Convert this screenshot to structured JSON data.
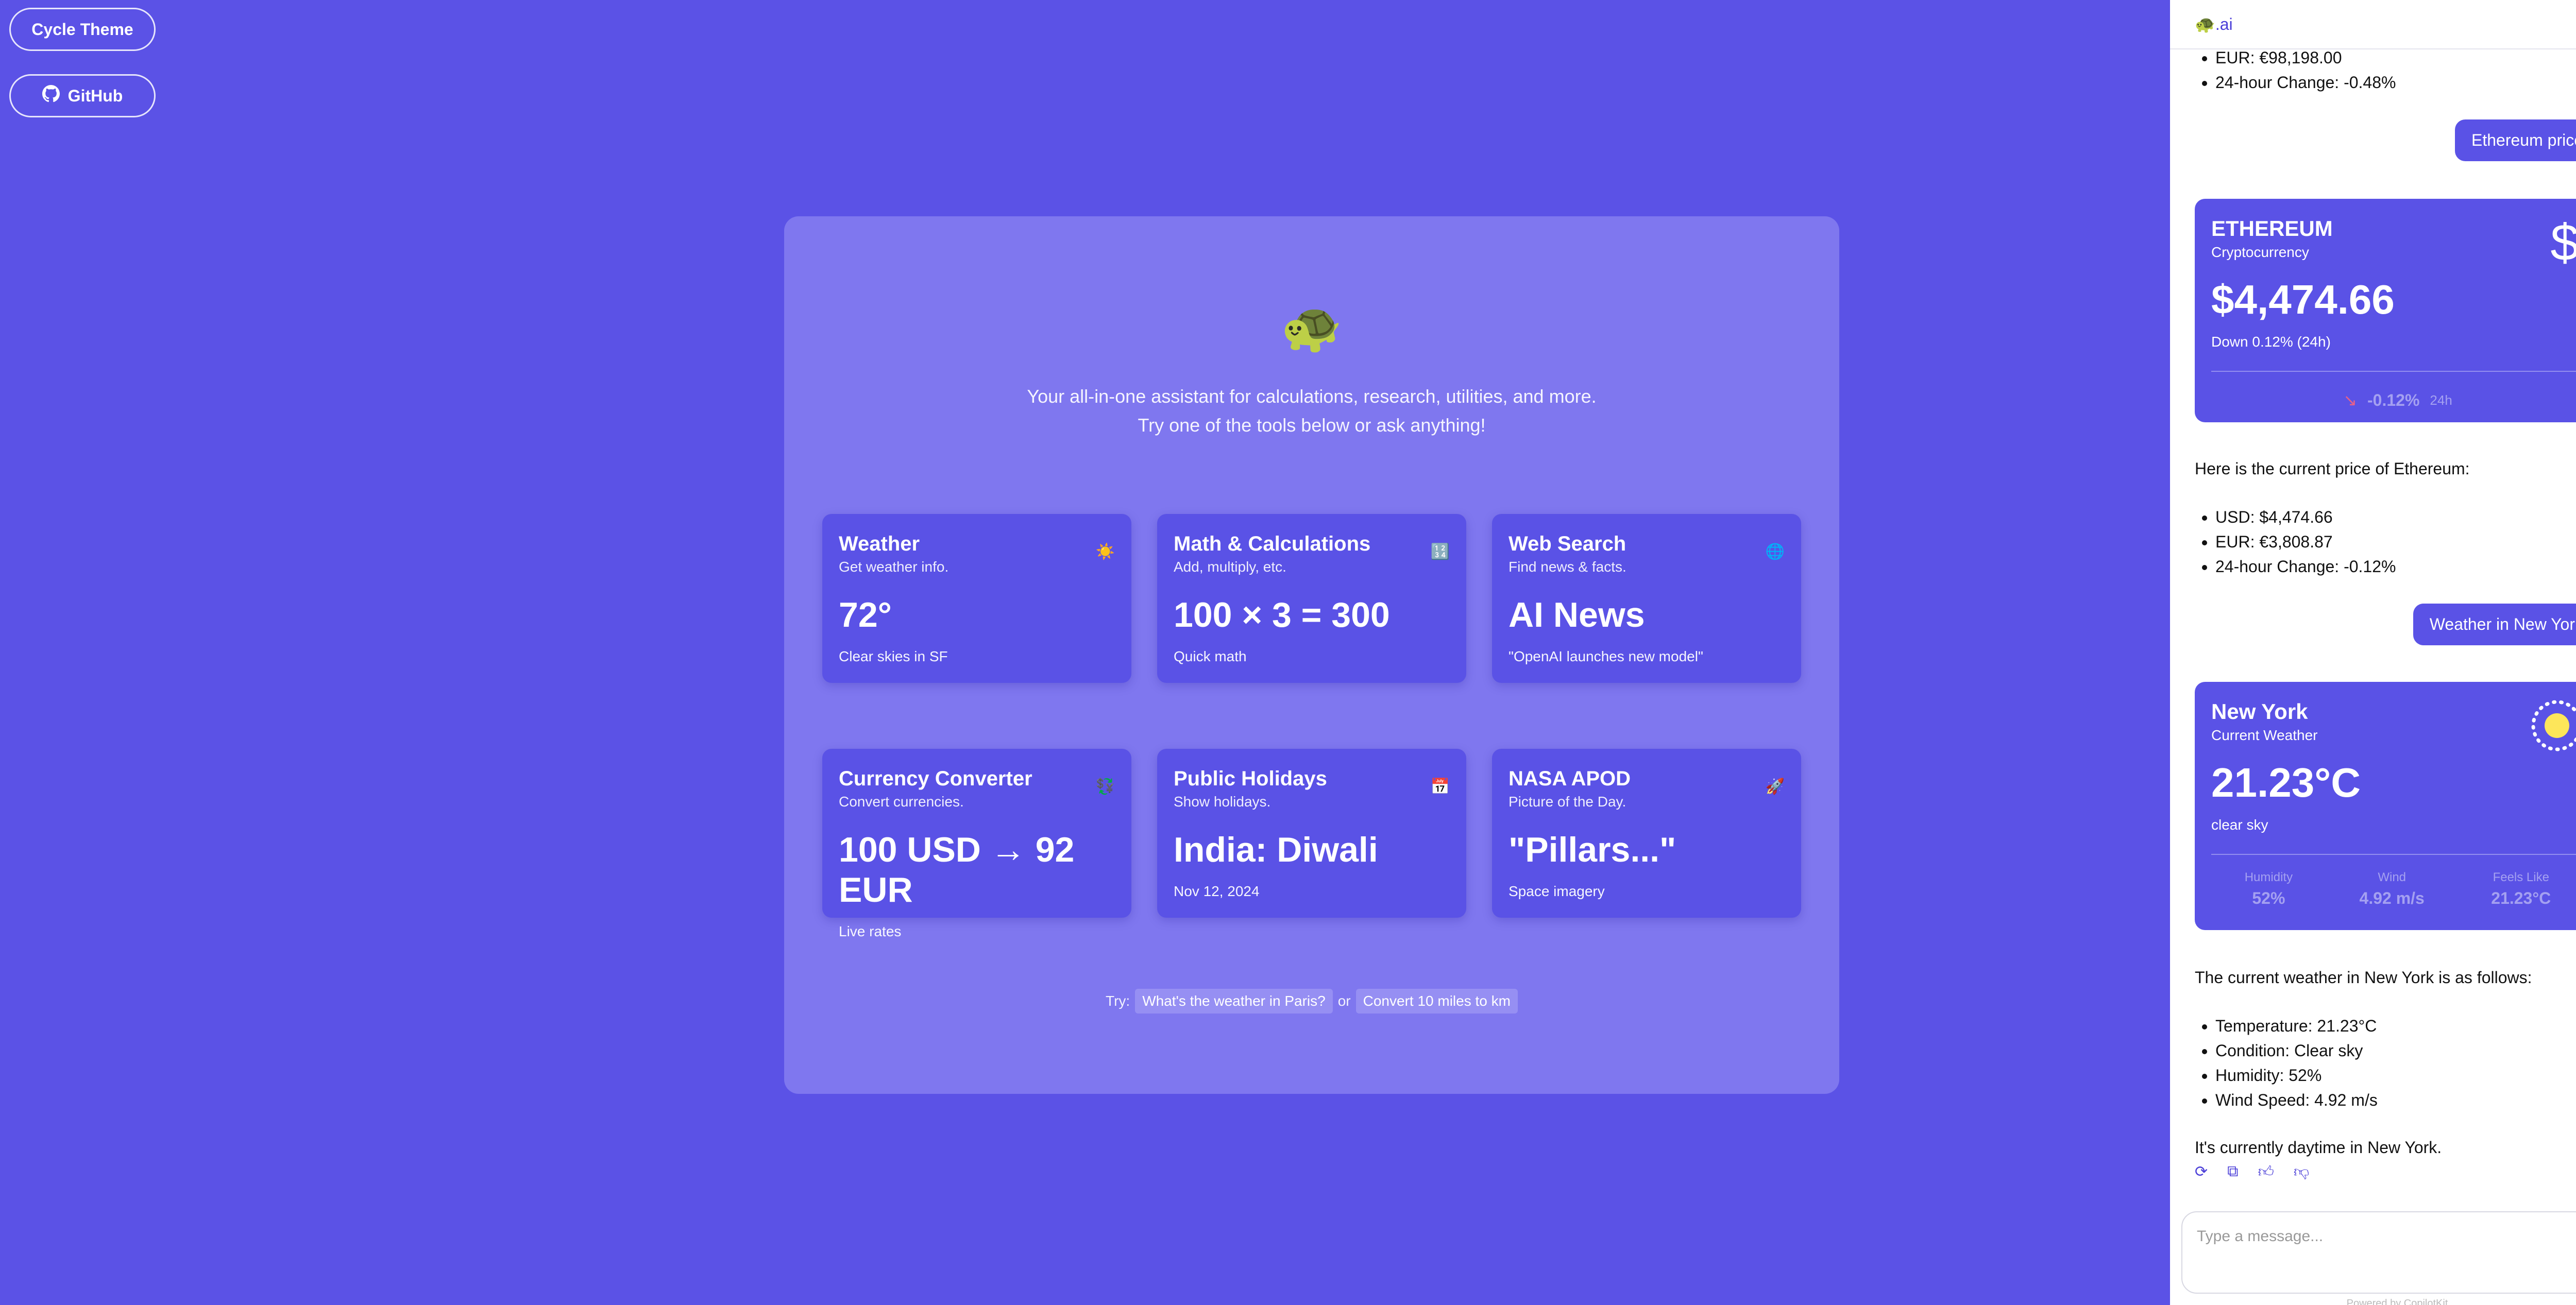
{
  "top_buttons": {
    "cycle_theme": "Cycle Theme",
    "github": "GitHub"
  },
  "hero": {
    "logo": "🐢",
    "line1": "Your all-in-one assistant for calculations, research, utilities, and more.",
    "line2": "Try one of the tools below or ask anything!"
  },
  "cards": [
    {
      "title": "Weather",
      "sub": "Get weather info.",
      "value": "72°",
      "note": "Clear skies in SF",
      "icon": "☀️"
    },
    {
      "title": "Math & Calculations",
      "sub": "Add, multiply, etc.",
      "value": "100 × 3 = 300",
      "note": "Quick math",
      "icon": "🔢"
    },
    {
      "title": "Web Search",
      "sub": "Find news & facts.",
      "value": "AI News",
      "note": "\"OpenAI launches new model\"",
      "icon": "🌐"
    },
    {
      "title": "Currency Converter",
      "sub": "Convert currencies.",
      "value": "100 USD → 92 EUR",
      "note": "Live rates",
      "icon": "💱"
    },
    {
      "title": "Public Holidays",
      "sub": "Show holidays.",
      "value": "India: Diwali",
      "note": "Nov 12, 2024",
      "icon": "📅"
    },
    {
      "title": "NASA APOD",
      "sub": "Picture of the Day.",
      "value": "\"Pillars...\"",
      "note": "Space imagery",
      "icon": "🚀"
    }
  ],
  "try": {
    "label": "Try:",
    "chip1": "What's the weather in Paris?",
    "or": "or",
    "chip2": "Convert 10 miles to km"
  },
  "chat": {
    "brand": "🐢.ai",
    "prev_items": [
      "EUR: €98,198.00",
      "24-hour Change: -0.48%"
    ],
    "user_msg1": "Ethereum price",
    "eth_card": {
      "title": "ETHEREUM",
      "sub": "Cryptocurrency",
      "value": "$4,474.66",
      "note": "Down 0.12% (24h)",
      "change": "-0.12%",
      "period": "24h",
      "icon": "dollar-icon"
    },
    "eth_intro": "Here is the current price of Ethereum:",
    "eth_items": [
      "USD: $4,474.66",
      "EUR: €3,808.87",
      "24-hour Change: -0.12%"
    ],
    "user_msg2": "Weather in New York",
    "weather_card": {
      "title": "New York",
      "sub": "Current Weather",
      "value": "21.23°C",
      "note": "clear sky",
      "stats": [
        {
          "label": "Humidity",
          "value": "52%"
        },
        {
          "label": "Wind",
          "value": "4.92 m/s"
        },
        {
          "label": "Feels Like",
          "value": "21.23°C"
        }
      ]
    },
    "weather_intro": "The current weather in New York is as follows:",
    "weather_items": [
      "Temperature: 21.23°C",
      "Condition: Clear sky",
      "Humidity: 52%",
      "Wind Speed: 4.92 m/s"
    ],
    "weather_outro": "It's currently daytime in New York.",
    "input_placeholder": "Type a message...",
    "powered": "Powered by CopilotKit"
  }
}
